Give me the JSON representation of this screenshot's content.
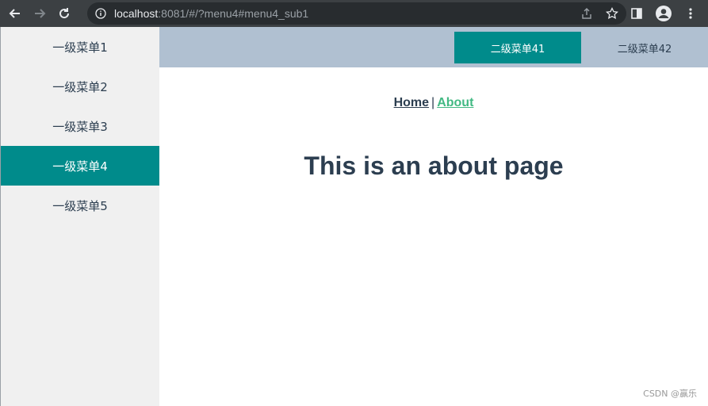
{
  "browser": {
    "url_host": "localhost",
    "url_rest": ":8081/#/?menu4#menu4_sub1"
  },
  "sidebar": {
    "items": [
      {
        "label": "一级菜单1",
        "active": false
      },
      {
        "label": "一级菜单2",
        "active": false
      },
      {
        "label": "一级菜单3",
        "active": false
      },
      {
        "label": "一级菜单4",
        "active": true
      },
      {
        "label": "一级菜单5",
        "active": false
      }
    ]
  },
  "topbar": {
    "tabs": [
      {
        "label": "二级菜单41",
        "active": true
      },
      {
        "label": "二级菜单42",
        "active": false
      }
    ]
  },
  "router_nav": {
    "home": "Home",
    "separator": "|",
    "about": "About"
  },
  "main": {
    "heading": "This is an about page"
  },
  "watermark": "CSDN @赢乐",
  "colors": {
    "accent": "#008b8b",
    "topbar_bg": "#b0c0d1",
    "sidebar_bg": "#f0f0f0",
    "text": "#2c3e50",
    "link_active": "#42b983"
  }
}
